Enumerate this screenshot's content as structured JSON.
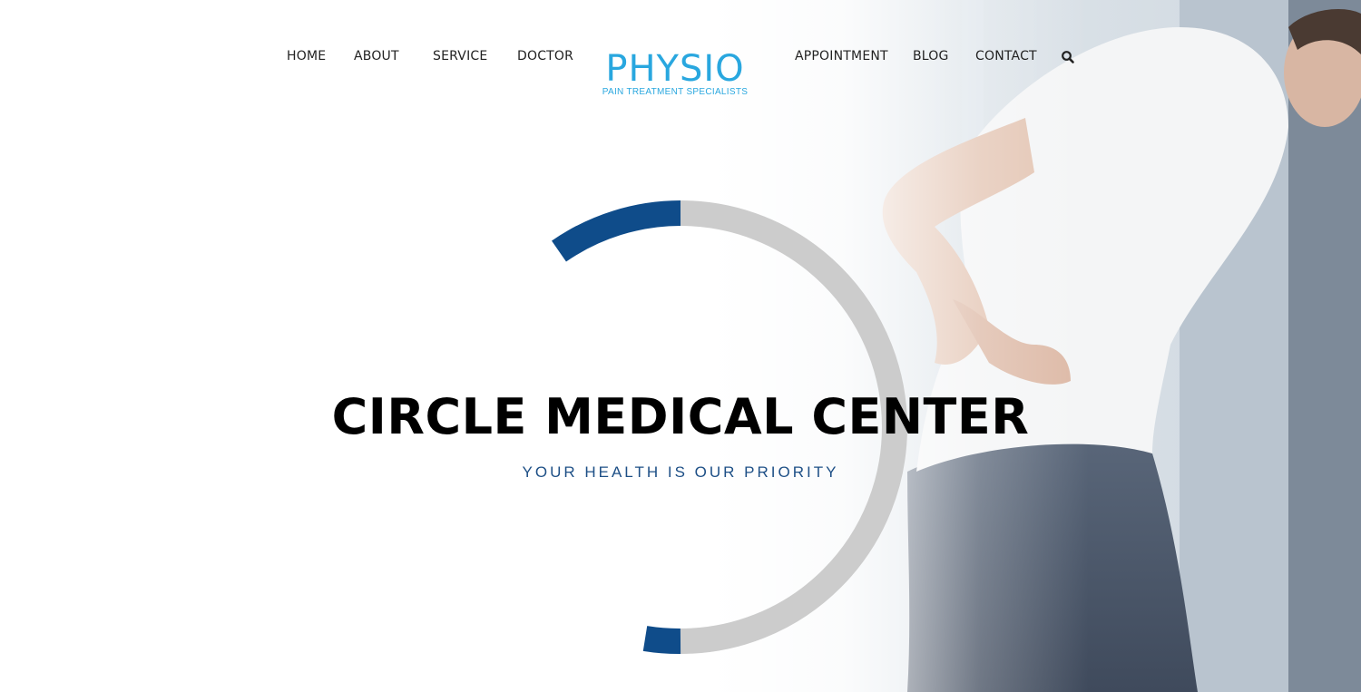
{
  "nav": {
    "left": [
      "HOME",
      "ABOUT",
      "SERVICE",
      "DOCTOR"
    ],
    "right": [
      "APPOINTMENT",
      "BLOG",
      "CONTACT"
    ]
  },
  "logo": {
    "title": "PHYSIO",
    "tagline": "PAIN TREATMENT SPECIALISTS"
  },
  "hero": {
    "title": "CIRCLE MEDICAL CENTER",
    "subtitle": "YOUR HEALTH IS OUR PRIORITY"
  },
  "colors": {
    "logo": "#29a7df",
    "ring_accent": "#0f4c8a",
    "ring_base": "#cccccc",
    "subtitle": "#1d4f86"
  },
  "icons": {
    "search": "search-icon"
  }
}
